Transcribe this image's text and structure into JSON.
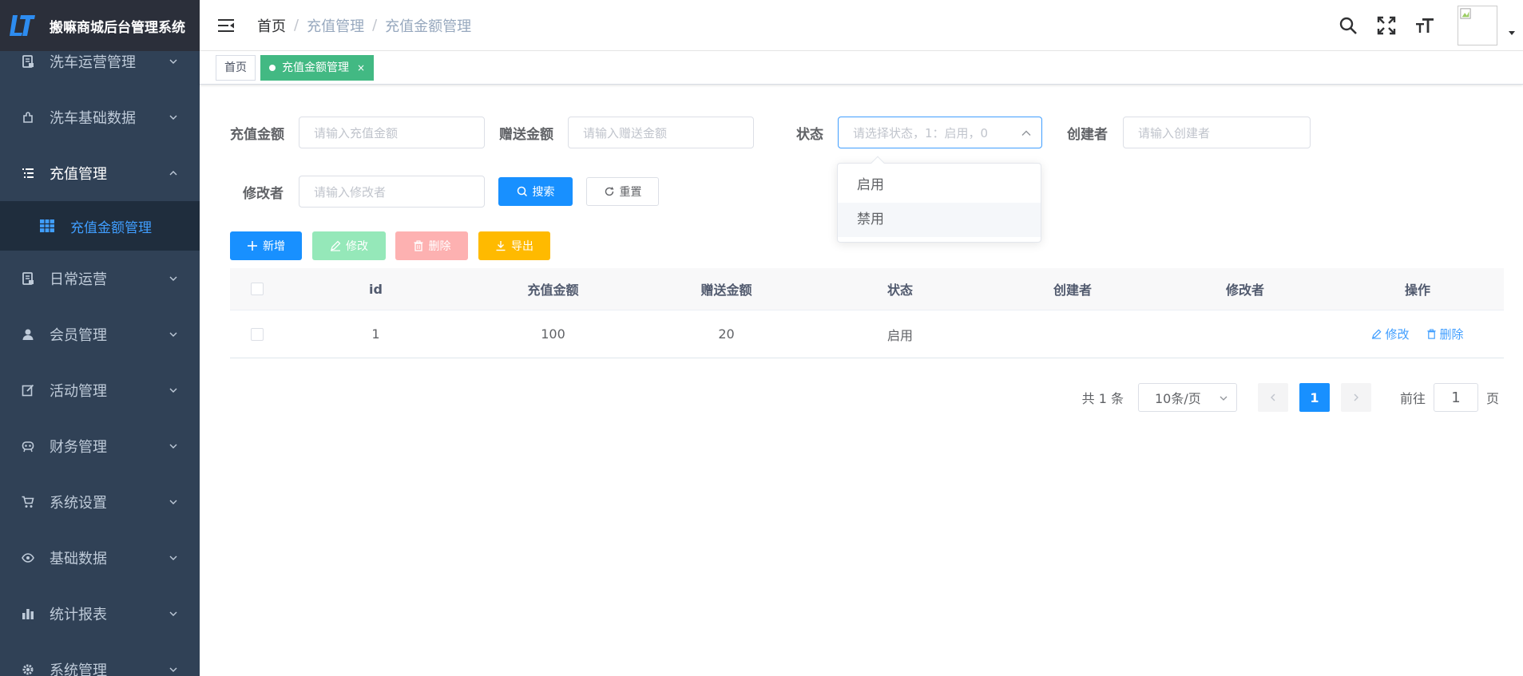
{
  "app": {
    "title": "搬嘛商城后台管理系统"
  },
  "sidebar": {
    "items": [
      {
        "label": "洗车运营管理",
        "icon": "document-icon"
      },
      {
        "label": "洗车基础数据",
        "icon": "puzzle-icon"
      },
      {
        "label": "充值管理",
        "icon": "list-icon",
        "open": true
      },
      {
        "label": "日常运营",
        "icon": "document-icon"
      },
      {
        "label": "会员管理",
        "icon": "user-icon"
      },
      {
        "label": "活动管理",
        "icon": "edit-icon"
      },
      {
        "label": "财务管理",
        "icon": "finance-icon"
      },
      {
        "label": "系统设置",
        "icon": "cart-icon"
      },
      {
        "label": "基础数据",
        "icon": "eye-icon"
      },
      {
        "label": "统计报表",
        "icon": "chart-icon"
      },
      {
        "label": "系统管理",
        "icon": "gear-icon"
      }
    ],
    "submenu": {
      "label": "充值金额管理",
      "icon": "table-icon"
    }
  },
  "breadcrumb": {
    "home": "首页",
    "parent": "充值管理",
    "current": "充值金额管理",
    "separator": "/"
  },
  "tags": {
    "home": "首页",
    "active": "充值金额管理",
    "close": "×"
  },
  "form": {
    "recharge_amount": {
      "label": "充值金额",
      "placeholder": "请输入充值金额"
    },
    "gift_amount": {
      "label": "赠送金额",
      "placeholder": "请输入赠送金额"
    },
    "status": {
      "label": "状态",
      "placeholder": "请选择状态，1：启用，0"
    },
    "creator": {
      "label": "创建者",
      "placeholder": "请输入创建者"
    },
    "modifier": {
      "label": "修改者",
      "placeholder": "请输入修改者"
    },
    "search_label": "搜索",
    "reset_label": "重置"
  },
  "dropdown": {
    "options": [
      "启用",
      "禁用"
    ]
  },
  "toolbar": {
    "add": "新增",
    "edit": "修改",
    "delete": "删除",
    "export": "导出"
  },
  "table": {
    "headers": [
      "id",
      "充值金额",
      "赠送金额",
      "状态",
      "创建者",
      "修改者",
      "操作"
    ],
    "rows": [
      {
        "id": "1",
        "amount": "100",
        "gift": "20",
        "status": "启用",
        "creator": "",
        "modifier": "",
        "edit": "修改",
        "delete": "删除"
      }
    ]
  },
  "pagination": {
    "total": "共 1 条",
    "page_size": "10条/页",
    "current_page": "1",
    "goto_label": "前往",
    "goto_value": "1",
    "page_suffix": "页"
  },
  "colors": {
    "sidebar_bg": "#304156",
    "primary": "#1890ff",
    "active_tag": "#42b983",
    "warning": "#ffba00"
  }
}
